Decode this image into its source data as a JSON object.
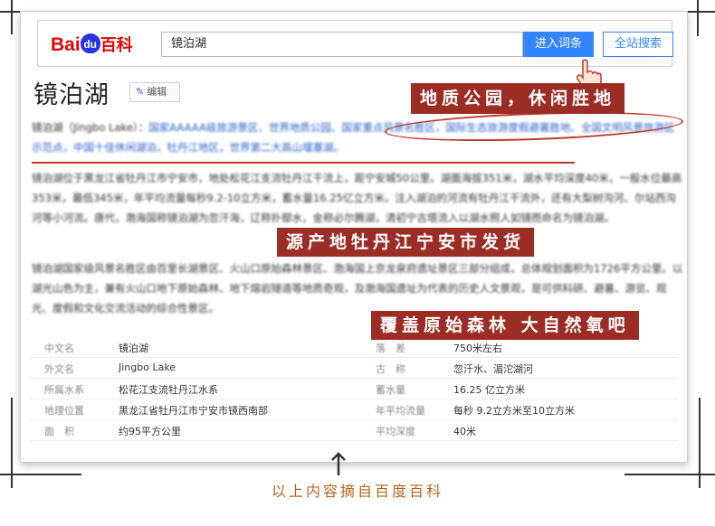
{
  "search": {
    "logo_bai": "Bai",
    "logo_du": "du",
    "logo_baike": "百科",
    "query": "镜泊湖",
    "enter_button": "进入词条",
    "site_search_button": "全站搜索"
  },
  "article": {
    "title": "镜泊湖",
    "edit_label": "编辑",
    "para1_start": "镜泊湖（Jingbo Lake）：",
    "para1_rest": "国家AAAAA级旅游景区、世界地质公园、国家重点风景名胜区，国际生态旅游度假避暑胜地、全国文明风景旅游区示范点，中国十佳休闲湖泊，牡丹江地区，世界第二大高山堰塞湖。",
    "para2": "镜泊湖位于黑龙江省牡丹江市宁安市，地处松花江支流牡丹江干流上，距宁安城50公里。湖面海拔351米，湖水平均深度40米，一般水位最高353米，最低345米，年平均流量每秒9.2-10立方米，蓄水量16.25亿立方米。注入湖泊的河流有牡丹江干流外，还有大梨树沟河、尔站西沟河等小河流。唐代，渤海国称镜泊湖为忽汗海，辽称扑鄢水，金称必尔腾湖，清初宁古塔流入以湖水照人如镜而命名为镜泊湖。",
    "para3": "镜泊湖国家级风景名胜区由百里长湖景区、火山口原始森林景区、渤海国上京龙泉府遗址景区三部分组成，总体规划面积为1726平方公里。以湖光山色为主，兼有火山口地下原始森林、地下熔岩隧道等地质奇观，及渤海国遗址为代表的历史人文景观，是可供科研、避暑、游览、观光、度假和文化交流活动的综合性景区。"
  },
  "banners": {
    "b1": "地质公园，休闲胜地",
    "b2": "源产地牡丹江宁安市发货",
    "b3": "覆盖原始森林 大自然氧吧"
  },
  "info_table": [
    {
      "k1": "中文名",
      "v1": "镜泊湖",
      "k2": "落　差",
      "v2": "750米左右"
    },
    {
      "k1": "外文名",
      "v1": "Jingbo Lake",
      "k2": "古　称",
      "v2": "忽汗水、湄沱湖河"
    },
    {
      "k1": "所属水系",
      "v1": "松花江支流牡丹江水系",
      "k2": "蓄水量",
      "v2": "16.25 亿立方米"
    },
    {
      "k1": "地理位置",
      "v1": "黑龙江省牡丹江市宁安市镜西南部",
      "k2": "年平均流量",
      "v2": "每秒 9.2立方米至10立方米"
    },
    {
      "k1": "面　积",
      "v1": "约95平方公里",
      "k2": "平均深度",
      "v2": "40米"
    }
  ],
  "caption": "以上内容摘自百度百科",
  "colors": {
    "banner_red": "#9b2d25",
    "baidu_blue": "#3385ff",
    "caption_orange": "#b5651d"
  }
}
